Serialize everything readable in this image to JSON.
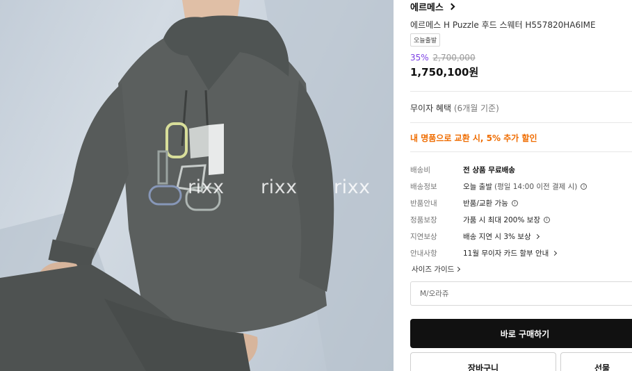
{
  "product_image": {
    "watermarks": [
      "rixx",
      "rixx",
      "rixx"
    ]
  },
  "product": {
    "brand": "에르메스",
    "title": "에르메스 H Puzzle 후드 스웨터 H557820HA6IME",
    "badge": "오늘출발",
    "discount": "35%",
    "original_price": "2,700,000",
    "price": "1,750,100원"
  },
  "benefits": {
    "interest_free": "무이자 혜택",
    "interest_free_sub": "(6개월 기준)",
    "trade_in_promo": "내 명품으로 교환 시, 5% 추가 할인"
  },
  "info": [
    {
      "key": "배송비",
      "value": "전 상품 무료배송",
      "strong": true
    },
    {
      "key": "배송정보",
      "value": "오늘 출발",
      "extra": "(평일 14:00 이전 결제 시)",
      "icon": "info-icon"
    },
    {
      "key": "반품안내",
      "value": "반품/교환 가능",
      "icon": "info-icon"
    },
    {
      "key": "정품보장",
      "value": "가품 시 최대 200% 보장",
      "icon": "info-icon"
    },
    {
      "key": "지연보상",
      "value": "배송 지연 시 3% 보상",
      "icon": "chevron-right-icon"
    },
    {
      "key": "안내사항",
      "value": "11월 무이자 카드 할부 안내",
      "icon": "chevron-right-icon"
    }
  ],
  "size_guide": "사이즈 가이드",
  "option_select": {
    "value": "M/오라쥬"
  },
  "buttons": {
    "buy_now": "바로 구매하기",
    "cart": "장바구니",
    "gift": "선물"
  },
  "colors": {
    "discount": "#7b3fe4",
    "promo": "#ef6c00",
    "buy_button": "#111111"
  }
}
